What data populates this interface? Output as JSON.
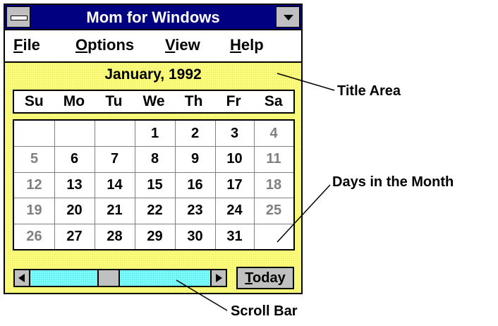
{
  "window": {
    "title": "Mom for Windows",
    "system_menu_icon": "system-menu-icon",
    "minimize_icon": "minimize-arrow-icon"
  },
  "menu": [
    {
      "underline": "F",
      "rest": "ile"
    },
    {
      "underline": "O",
      "rest": "ptions"
    },
    {
      "underline": "V",
      "rest": "iew"
    },
    {
      "underline": "H",
      "rest": "elp"
    }
  ],
  "calendar": {
    "month_label": "January, 1992",
    "weekdays": [
      "Su",
      "Mo",
      "Tu",
      "We",
      "Th",
      "Fr",
      "Sa"
    ],
    "weeks": [
      [
        "",
        "",
        "",
        "1",
        "2",
        "3",
        "4"
      ],
      [
        "5",
        "6",
        "7",
        "8",
        "9",
        "10",
        "11"
      ],
      [
        "12",
        "13",
        "14",
        "15",
        "16",
        "17",
        "18"
      ],
      [
        "19",
        "20",
        "21",
        "22",
        "23",
        "24",
        "25"
      ],
      [
        "26",
        "27",
        "28",
        "29",
        "30",
        "31",
        ""
      ]
    ]
  },
  "scrollbar": {
    "left_icon": "scroll-left-arrow-icon",
    "right_icon": "scroll-right-arrow-icon"
  },
  "today_button": {
    "underline": "T",
    "rest": "oday"
  },
  "callouts": {
    "title_area": "Title Area",
    "days_in_month": "Days in the Month",
    "scroll_bar": "Scroll Bar"
  },
  "colors": {
    "title_bar": "#000080",
    "calendar_background": "#ffff80",
    "scroll_track": "#80ffff",
    "weekend_text": "#808080",
    "button_face": "#c0c0c0"
  }
}
